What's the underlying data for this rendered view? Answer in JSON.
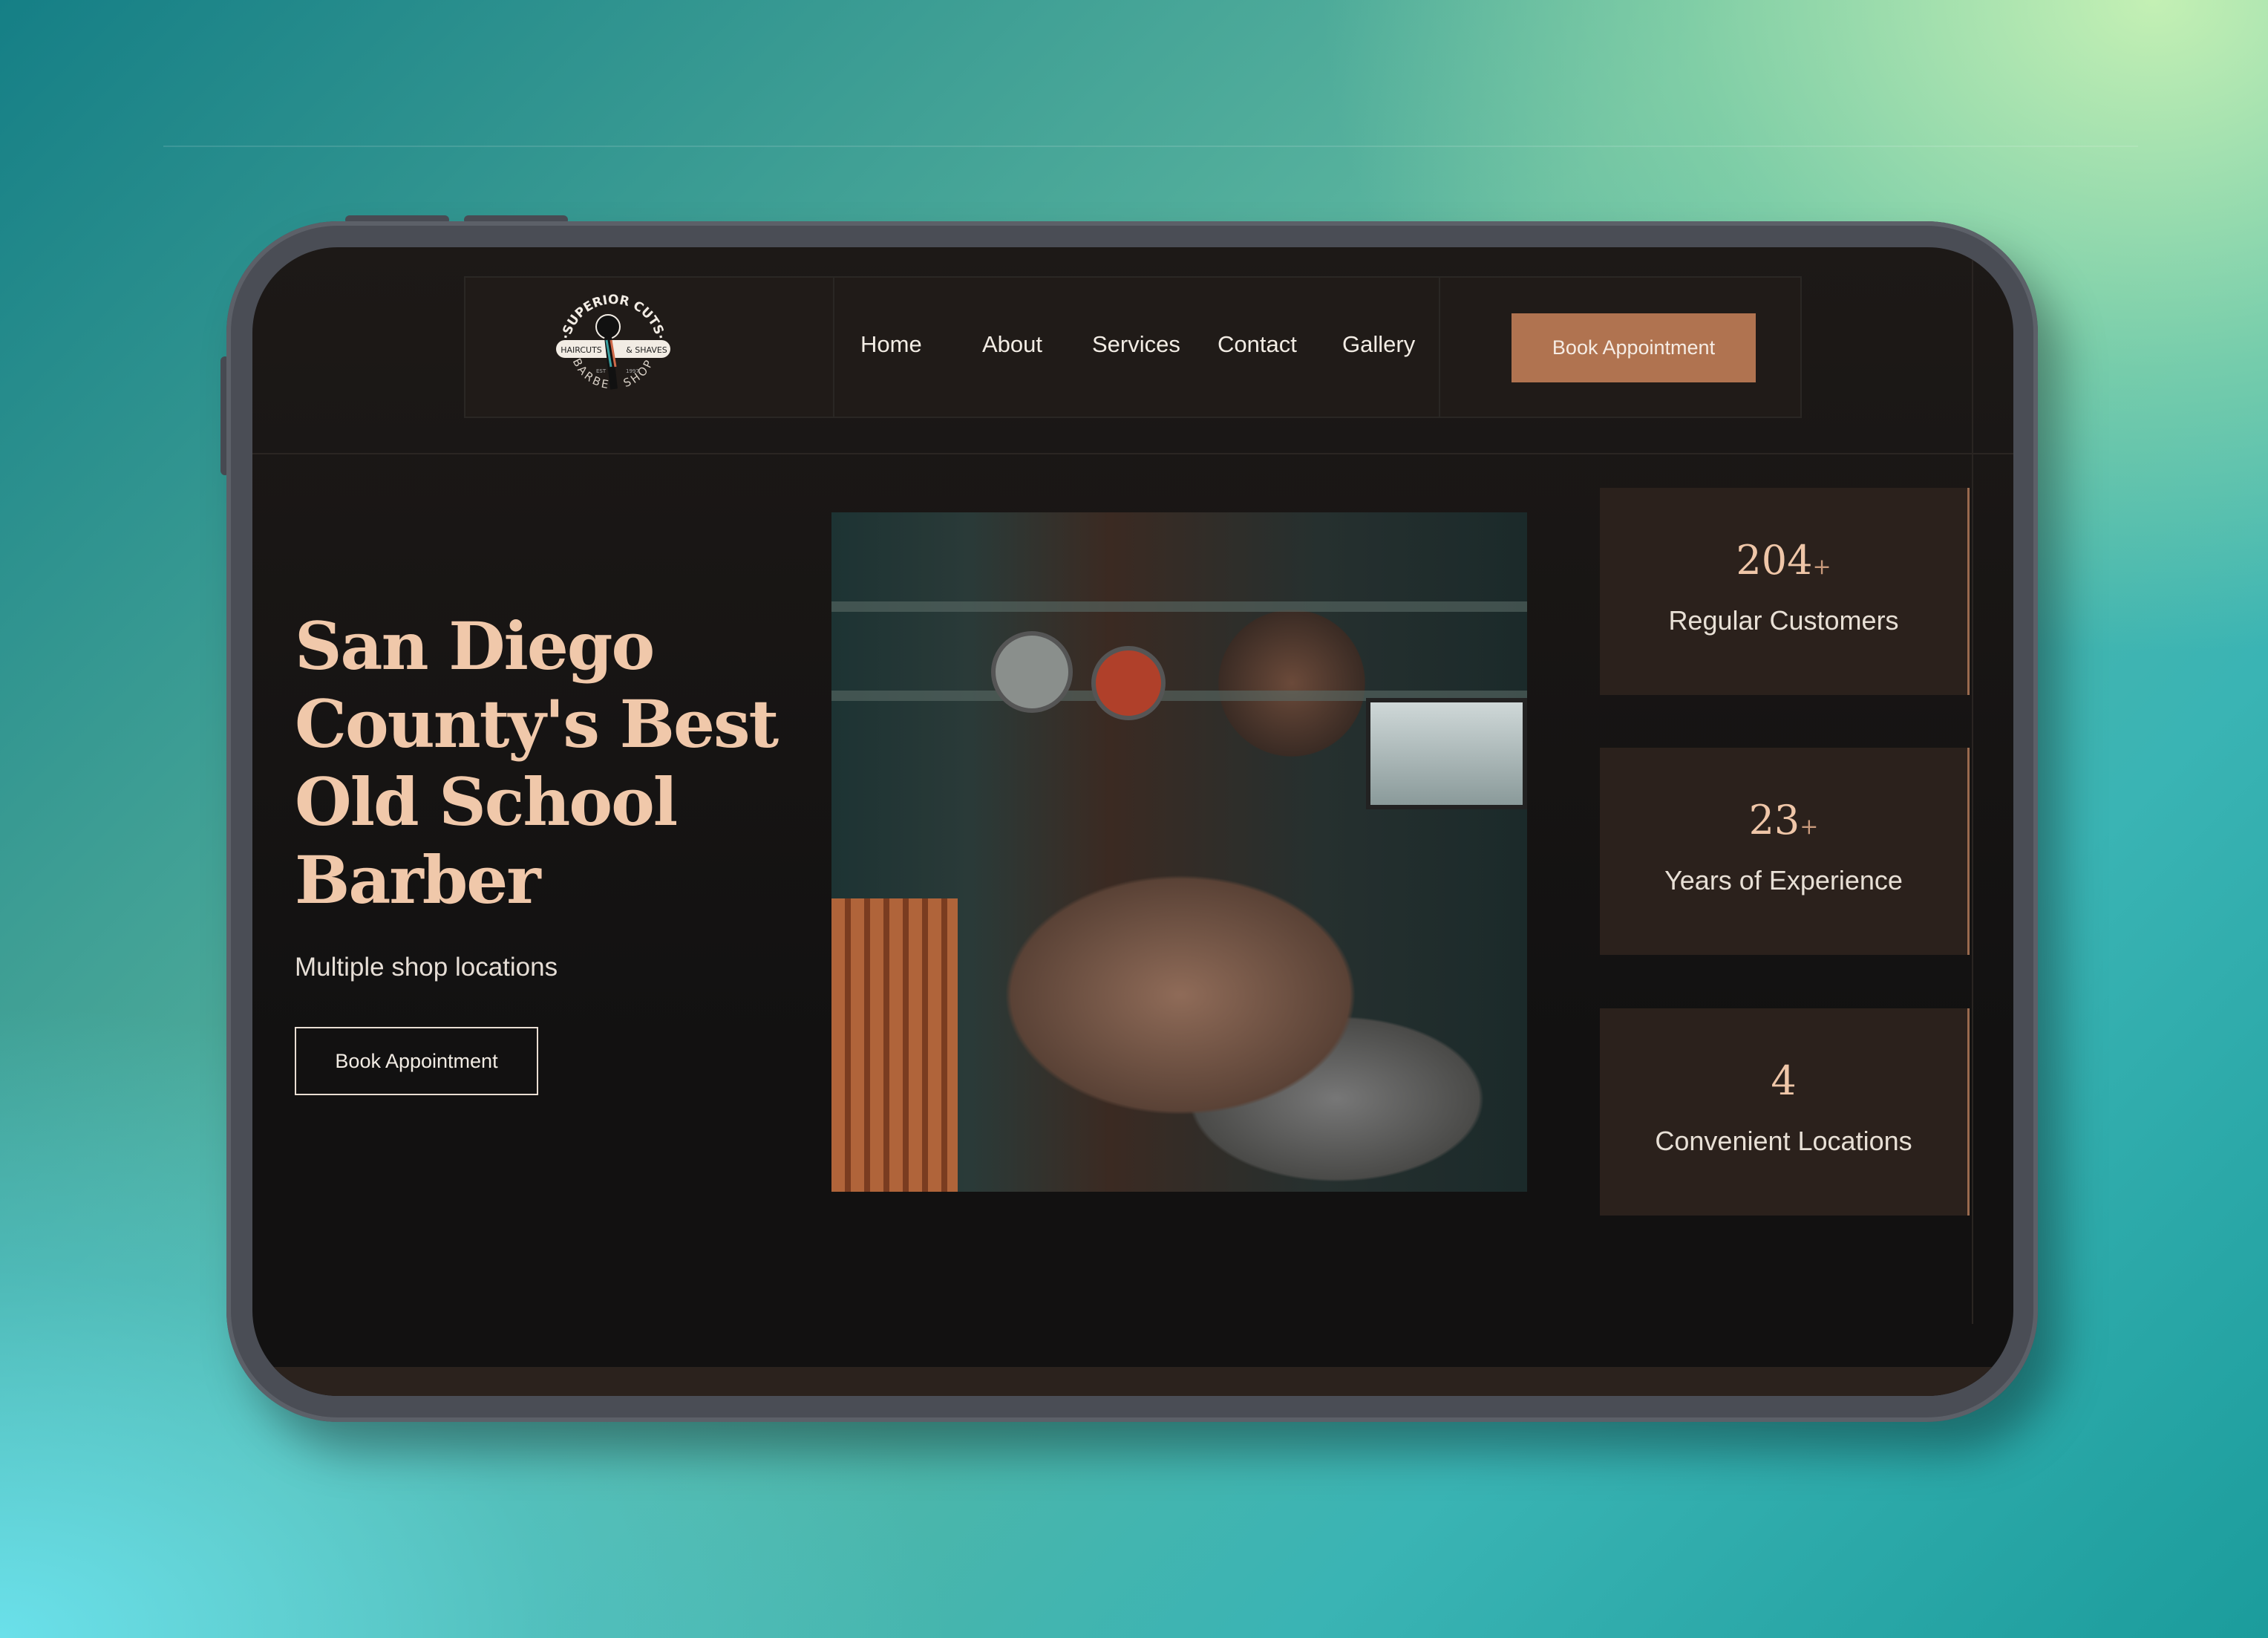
{
  "brand": {
    "name": "Superior Cuts",
    "logo_text": [
      "SUPERIOR CUTS",
      "HAIRCUTS",
      "& SHAVES",
      "EST",
      "1997",
      "BARBER SHOP"
    ]
  },
  "nav": {
    "items": [
      {
        "label": "Home"
      },
      {
        "label": "About"
      },
      {
        "label": "Services"
      },
      {
        "label": "Contact"
      },
      {
        "label": "Gallery"
      }
    ],
    "cta": "Book Appointment"
  },
  "hero": {
    "title": "San Diego County's Best Old School Barber",
    "subtitle": "Multiple shop locations",
    "cta": "Book Appointment"
  },
  "stats": [
    {
      "value": "204",
      "suffix": "+",
      "label": "Regular Customers"
    },
    {
      "value": "23",
      "suffix": "+",
      "label": "Years of Experience"
    },
    {
      "value": "4",
      "suffix": "",
      "label": "Convenient Locations"
    }
  ],
  "colors": {
    "accent": "#b07350",
    "heading": "#f0c8aa",
    "background": "#1d1917",
    "card": "#2b211c"
  }
}
